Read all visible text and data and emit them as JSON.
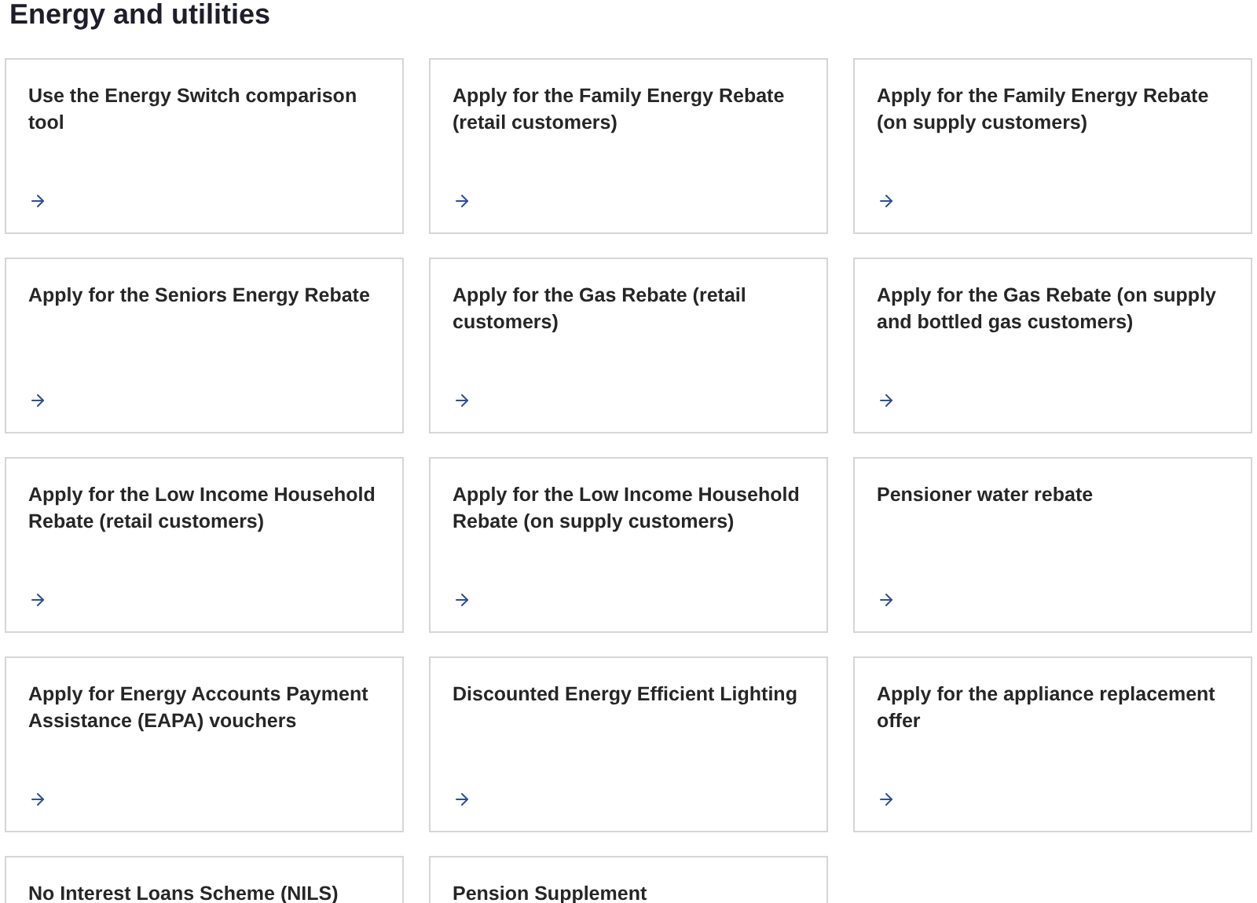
{
  "heading": "Energy and utilities",
  "cards": [
    {
      "title": "Use the Energy Switch comparison tool"
    },
    {
      "title": "Apply for the Family Energy Rebate (retail customers)"
    },
    {
      "title": "Apply for the Family Energy Rebate (on supply customers)"
    },
    {
      "title": "Apply for the Seniors Energy Rebate"
    },
    {
      "title": "Apply for the Gas Rebate (retail customers)"
    },
    {
      "title": "Apply for the Gas Rebate (on supply and bottled gas customers)"
    },
    {
      "title": "Apply for the Low Income Household Rebate (retail customers)"
    },
    {
      "title": "Apply for the Low Income Household Rebate (on supply customers)"
    },
    {
      "title": "Pensioner water rebate"
    },
    {
      "title": "Apply for Energy Accounts Payment Assistance (EAPA) vouchers"
    },
    {
      "title": "Discounted Energy Efficient Lighting"
    },
    {
      "title": "Apply for the appliance replacement offer"
    },
    {
      "title": "No Interest Loans Scheme (NILS)"
    },
    {
      "title": "Pension Supplement"
    }
  ]
}
